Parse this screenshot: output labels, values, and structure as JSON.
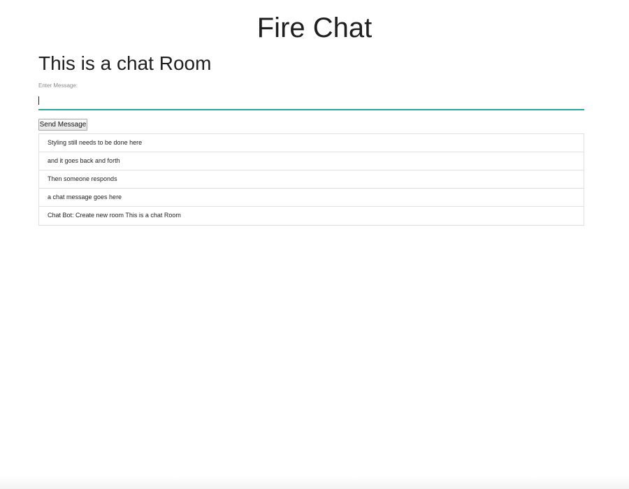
{
  "header": {
    "app_title": "Fire Chat"
  },
  "room": {
    "title": "This is a chat Room"
  },
  "composer": {
    "label": "Enter Message:",
    "value": "",
    "send_label": "Send Message"
  },
  "messages": [
    "Styling still needs to be done here",
    "and it goes back and forth",
    "Then someone responds",
    "a chat message goes here",
    "Chat Bot: Create new room This is a chat Room"
  ],
  "colors": {
    "input_underline": "#26a69a",
    "list_border": "#e0e0e0"
  }
}
